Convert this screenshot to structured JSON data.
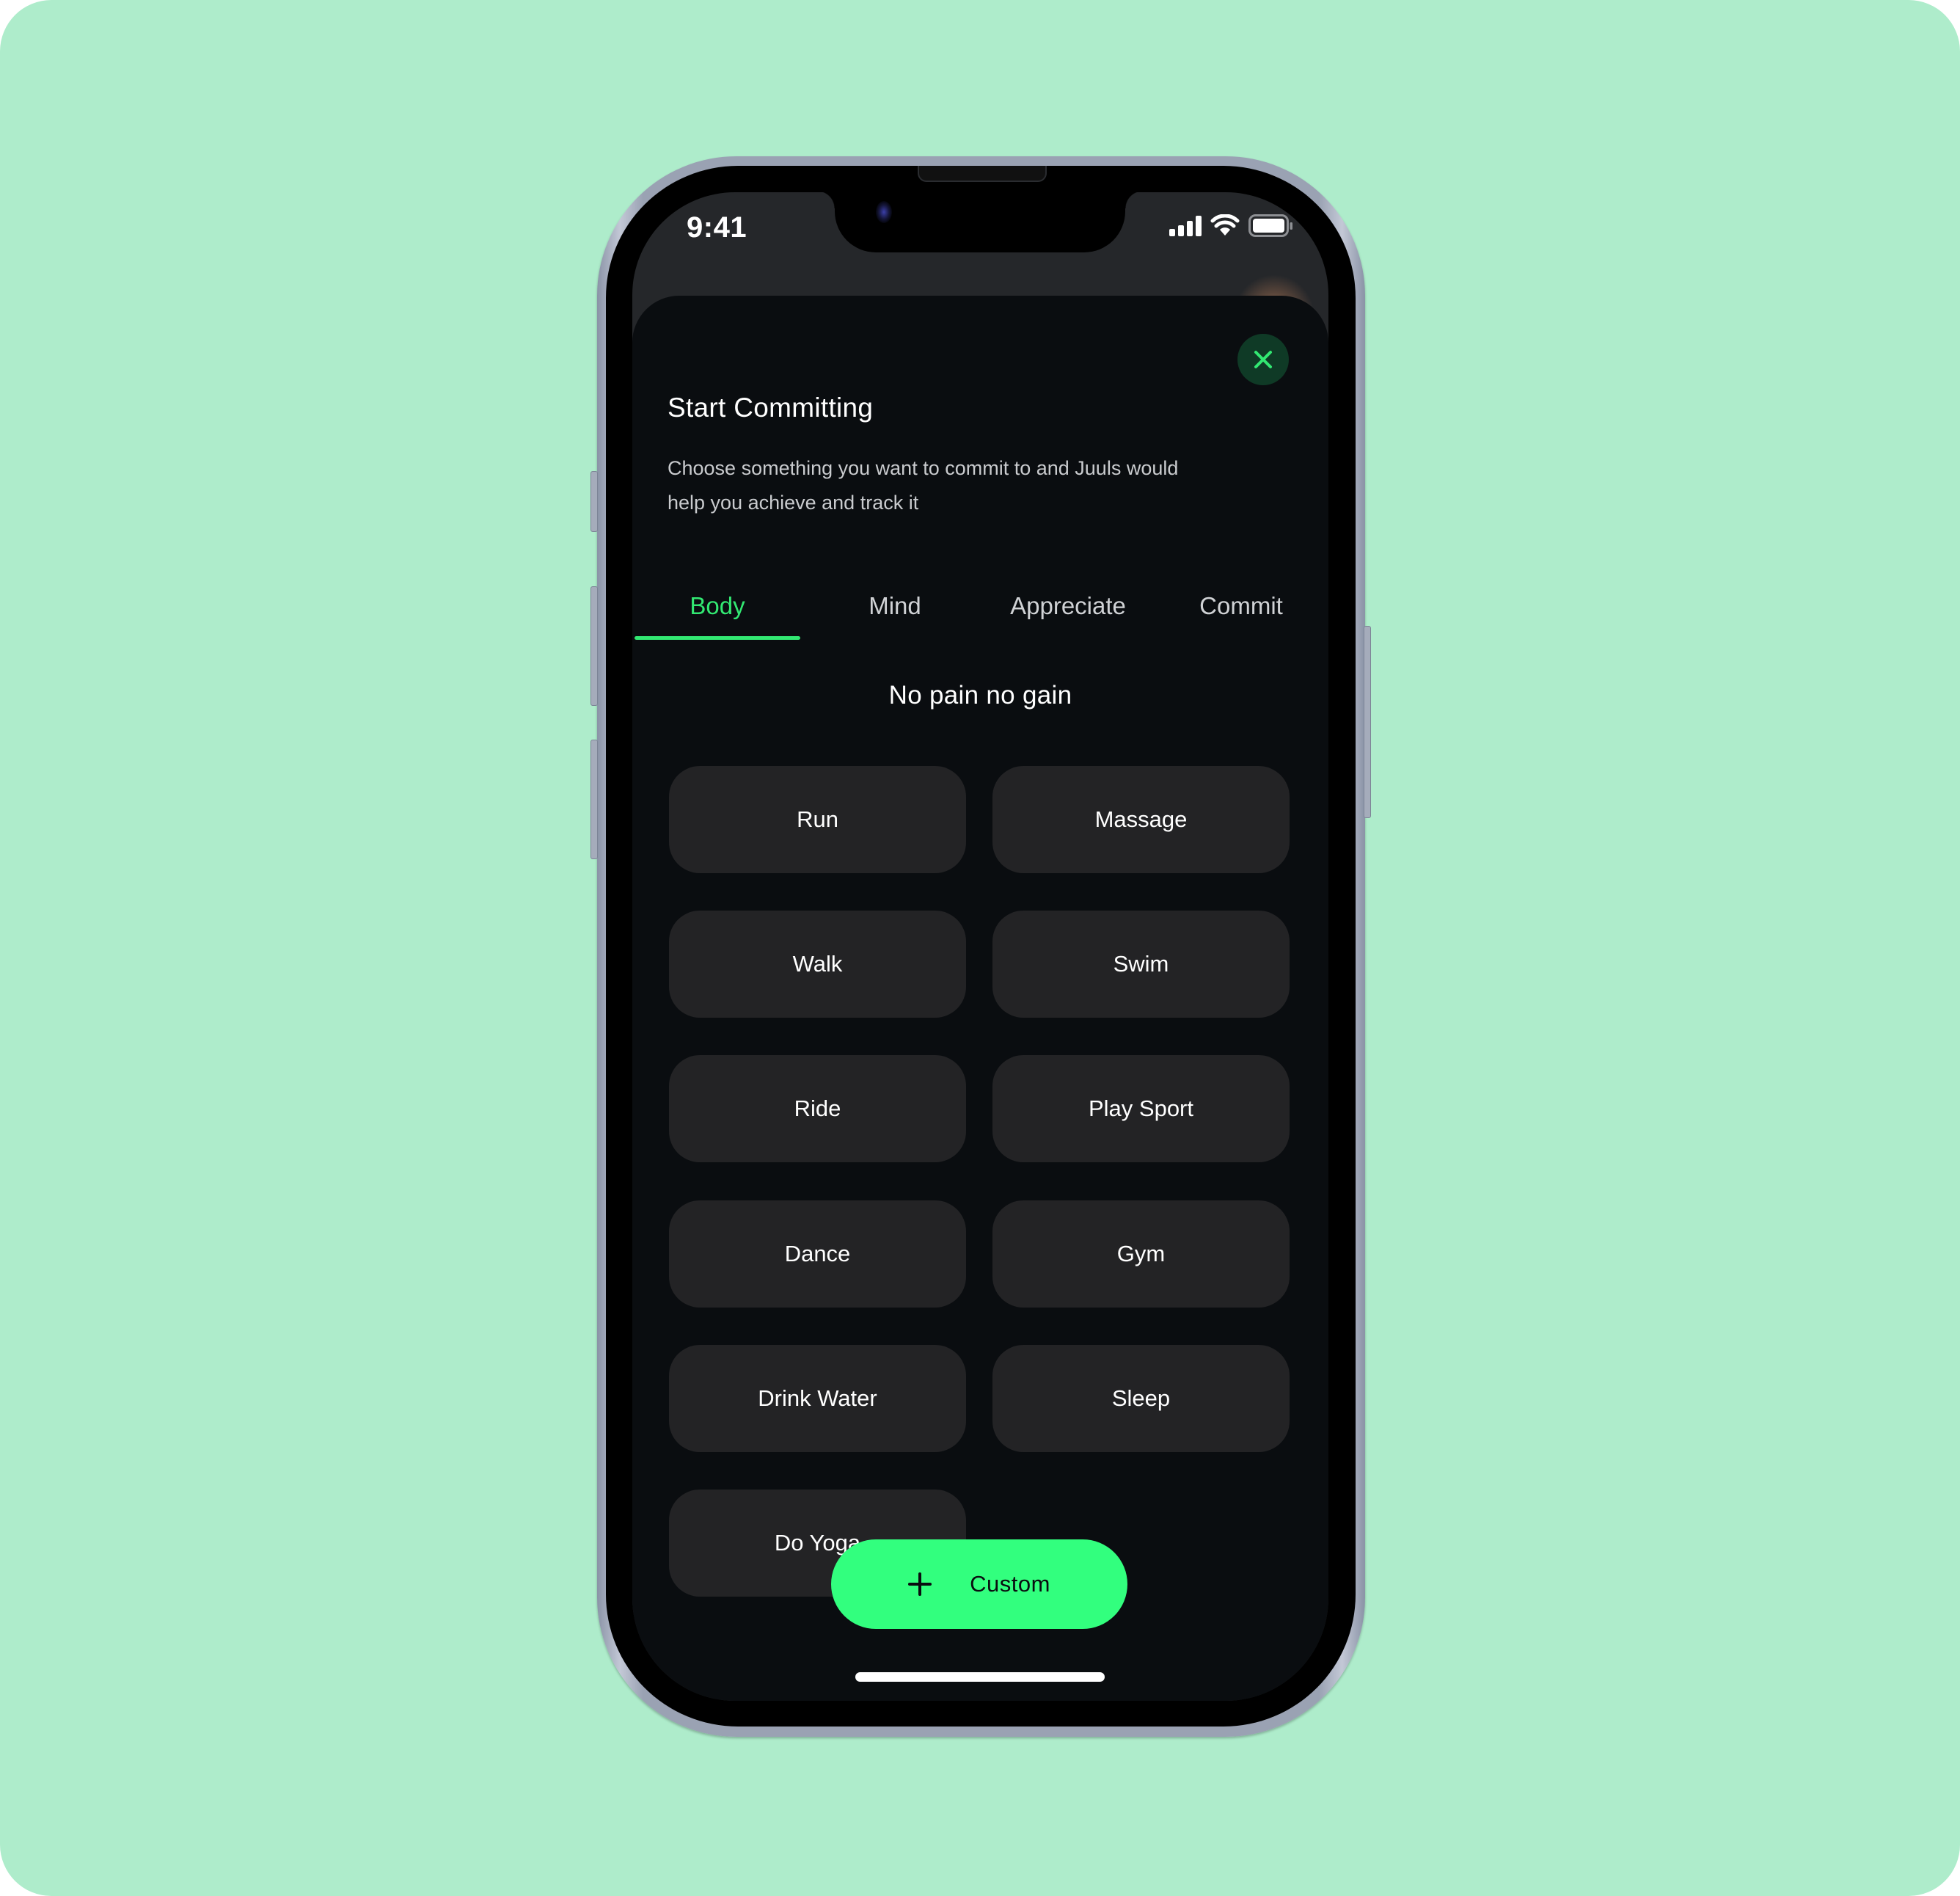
{
  "status_bar": {
    "time": "9:41",
    "icons": [
      "cellular-signal-icon",
      "wifi-icon",
      "battery-icon"
    ]
  },
  "sheet": {
    "close_icon": "close-icon",
    "title": "Start Committing",
    "description_line1": "Choose something you want to commit to and Juuls would",
    "description_line2": "help you achieve and track it",
    "tabs": [
      {
        "label": "Body",
        "active": true
      },
      {
        "label": "Mind",
        "active": false
      },
      {
        "label": "Appreciate",
        "active": false
      },
      {
        "label": "Commit",
        "active": false
      }
    ],
    "section_heading": "No pain no gain",
    "options": [
      {
        "label": "Run"
      },
      {
        "label": "Massage"
      },
      {
        "label": "Walk"
      },
      {
        "label": "Swim"
      },
      {
        "label": "Ride"
      },
      {
        "label": "Play Sport"
      },
      {
        "label": "Dance"
      },
      {
        "label": "Gym"
      },
      {
        "label": "Drink Water"
      },
      {
        "label": "Sleep"
      },
      {
        "label": "Do Yoga"
      }
    ],
    "custom_button": {
      "icon": "plus-icon",
      "label": "Custom"
    }
  },
  "colors": {
    "background": "#aeeccb",
    "accent": "#32e872",
    "custom_button": "#32ff7e",
    "sheet": "#0a0d10",
    "option_bg": "#232325",
    "close_bg": "#0f3a26"
  }
}
